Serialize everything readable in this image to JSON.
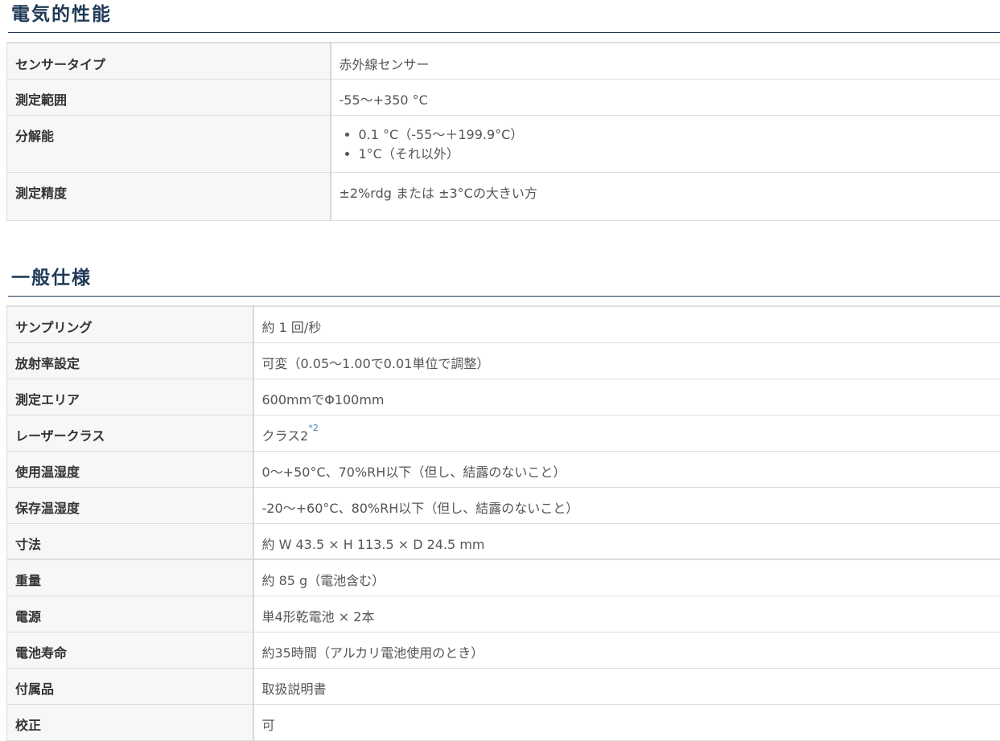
{
  "electrical": {
    "title": "電気的性能",
    "rows": [
      {
        "label": "センサータイプ",
        "value": "赤外線センサー"
      },
      {
        "label": "測定範囲",
        "value": "-55～+350 °C"
      },
      {
        "label": "分解能",
        "items": [
          "0.1 °C（-55～＋199.9°C）",
          "1°C（それ以外）"
        ]
      },
      {
        "label": "測定精度",
        "value": "±2%rdg または ±3°Cの大きい方"
      }
    ]
  },
  "general": {
    "title": "一般仕様",
    "rows": [
      {
        "label": "サンプリング",
        "value": "約 1 回/秒"
      },
      {
        "label": "放射率設定",
        "value": "可変（0.05～1.00で0.01単位で調整）"
      },
      {
        "label": "測定エリア",
        "value": "600mmでΦ100mm"
      },
      {
        "label": "レーザークラス",
        "value": "クラス2",
        "note": "*2"
      },
      {
        "label": "使用温湿度",
        "value": "0～+50°C、70%RH以下（但し、結露のないこと）"
      },
      {
        "label": "保存温湿度",
        "value": "-20～+60°C、80%RH以下（但し、結露のないこと）"
      },
      {
        "label": "寸法",
        "value": "約 W 43.5 × H 113.5 × D 24.5 mm"
      },
      {
        "label": "重量",
        "value": "約 85 g（電池含む）"
      },
      {
        "label": "電源",
        "value": "単4形乾電池 × 2本"
      },
      {
        "label": "電池寿命",
        "value": "約35時間（アルカリ電池使用のとき）"
      },
      {
        "label": "付属品",
        "value": "取扱説明書"
      },
      {
        "label": "校正",
        "value": "可"
      }
    ]
  }
}
